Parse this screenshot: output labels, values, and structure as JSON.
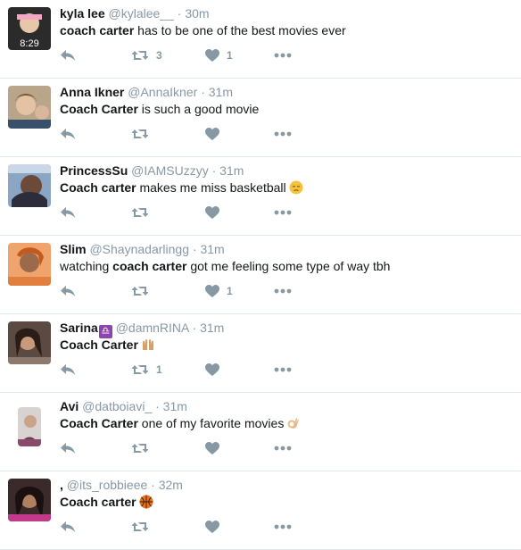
{
  "colors": {
    "icon_gray": "#8899a6",
    "text": "#14171a",
    "divider": "#e1e8ed"
  },
  "icons": {
    "reply": "reply-icon",
    "retweet": "retweet-icon",
    "like": "heart-icon",
    "more": "more-icon"
  },
  "tweets": [
    {
      "fullname": "kyla lee",
      "username": "@kylalee__",
      "sep": "·",
      "time": "30m",
      "text_pre": "",
      "text_bold": "coach carter",
      "text_post": " has to be one of the best movies ever",
      "emoji": "",
      "retweets": "3",
      "likes": "1"
    },
    {
      "fullname": "Anna Ikner",
      "username": "@AnnaIkner",
      "sep": "·",
      "time": "31m",
      "text_pre": "",
      "text_bold": "Coach Carter",
      "text_post": " is such a good movie",
      "emoji": "",
      "retweets": "",
      "likes": ""
    },
    {
      "fullname": "PrincessSu",
      "username": "@IAMSUzzyy",
      "sep": "·",
      "time": "31m",
      "text_pre": "",
      "text_bold": "Coach carter",
      "text_post": " makes me miss basketball",
      "emoji": "pensive-face-emoji",
      "retweets": "",
      "likes": ""
    },
    {
      "fullname": "Slim",
      "username": "@Shaynadarlingg",
      "sep": "·",
      "time": "31m",
      "text_pre": "watching ",
      "text_bold": "coach carter",
      "text_post": " got me feeling some type of way tbh",
      "emoji": "",
      "retweets": "",
      "likes": "1"
    },
    {
      "fullname": "Sarina",
      "username": "@damnRINA",
      "sep": "·",
      "time": "31m",
      "name_badge": "♎",
      "text_pre": "",
      "text_bold": "Coach Carter",
      "text_post": "",
      "emoji": "raised-hands-emoji",
      "retweets": "1",
      "likes": ""
    },
    {
      "fullname": "Avi",
      "username": "@datboiavi_",
      "sep": "·",
      "time": "31m",
      "text_pre": "",
      "text_bold": "Coach Carter",
      "text_post": " one of my favorite movies",
      "emoji": "ok-hand-emoji",
      "retweets": "",
      "likes": ""
    },
    {
      "fullname": ",",
      "username": "@its_robbieee",
      "sep": "·",
      "time": "32m",
      "text_pre": "",
      "text_bold": "Coach carter",
      "text_post": "",
      "emoji": "basketball-emoji",
      "retweets": "",
      "likes": ""
    }
  ]
}
